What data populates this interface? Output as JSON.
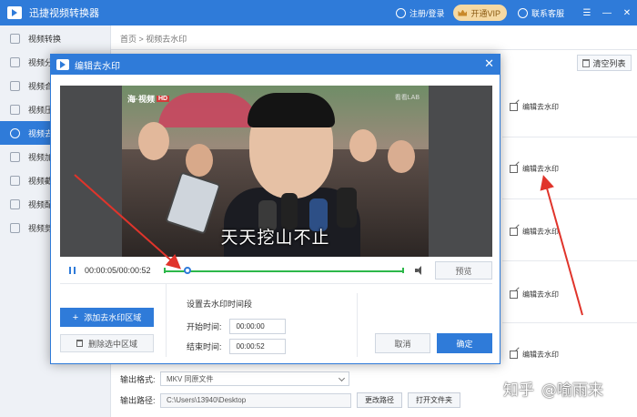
{
  "titlebar": {
    "app_title": "迅捷视频转换器",
    "login_label": "注册/登录",
    "vip_label": "开通VIP",
    "service_label": "联系客服",
    "menu_glyph": "☰",
    "minimize_glyph": "—",
    "close_glyph": "✕"
  },
  "sidebar": {
    "items": [
      {
        "label": "视频转换",
        "icon": "convert-icon",
        "active": false
      },
      {
        "label": "视频分",
        "icon": "split-icon",
        "active": false
      },
      {
        "label": "视频合",
        "icon": "merge-icon",
        "active": false
      },
      {
        "label": "视频压",
        "icon": "compress-icon",
        "active": false
      },
      {
        "label": "视频去",
        "icon": "play-circle-icon",
        "active": true
      },
      {
        "label": "视频加",
        "icon": "add-icon",
        "active": false
      },
      {
        "label": "视频截",
        "icon": "image-icon",
        "active": false
      },
      {
        "label": "视频配",
        "icon": "music-icon",
        "active": false
      },
      {
        "label": "视频剪",
        "icon": "scissors-icon",
        "active": false
      }
    ]
  },
  "main": {
    "breadcrumb": "首页 > 视频去水印",
    "clear_list": "清空列表",
    "edit_link_label": "编辑去水印",
    "output": {
      "format_label": "输出格式:",
      "format_value": "MKV  同原文件",
      "path_label": "输出路径:",
      "path_value": "C:\\Users\\13940\\Desktop",
      "change_path": "更改路径",
      "open_folder": "打开文件夹"
    }
  },
  "dialog": {
    "title": "编辑去水印",
    "close_glyph": "✕",
    "video": {
      "logo_left": "海·视频",
      "logo_badge": "HD",
      "logo_right": "看看LAB",
      "subtitle": "天天挖山不止"
    },
    "controls": {
      "time": "00:00:05/00:00:52",
      "progress": 0.1,
      "preview": "预览"
    },
    "add_area": "添加去水印区域",
    "delete_area": "删除选中区域",
    "time_section": "设置去水印时间段",
    "start_label": "开始时间:",
    "start_value": "00:00:00",
    "end_label": "结束时间:",
    "end_value": "00:00:52",
    "cancel": "取消",
    "confirm": "确定"
  },
  "watermark": {
    "site": "知乎",
    "user": "@喻雨来"
  },
  "colors": {
    "primary": "#2f7bd9",
    "progress": "#2db84a",
    "vip": "#f5d9a3",
    "annotation": "#e0342b"
  }
}
